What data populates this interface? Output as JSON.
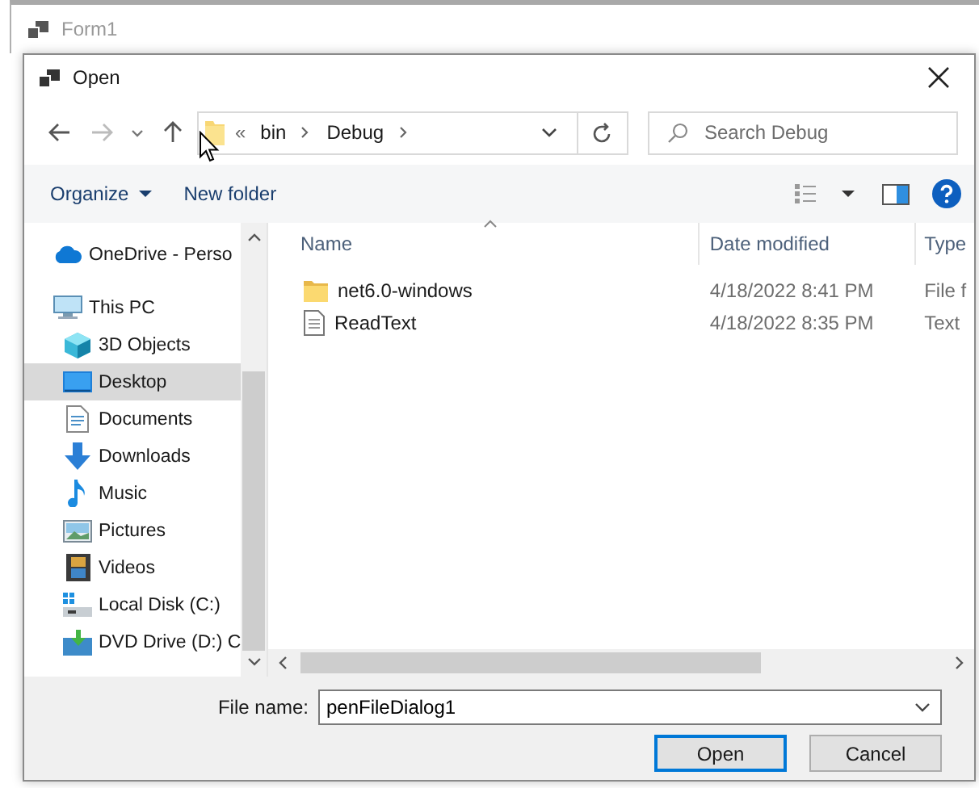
{
  "form": {
    "title": "Form1"
  },
  "dialog": {
    "title": "Open"
  },
  "address": {
    "overflow": "«",
    "segments": [
      "bin",
      "Debug"
    ]
  },
  "search": {
    "placeholder": "Search Debug"
  },
  "toolbar": {
    "organize": "Organize",
    "new_folder": "New folder"
  },
  "sidebar": {
    "items": [
      {
        "label": "OneDrive - Perso",
        "kind": "cloud",
        "selected": false
      },
      {
        "label": "This PC",
        "kind": "pc",
        "selected": false
      },
      {
        "label": "3D Objects",
        "kind": "cube",
        "selected": false
      },
      {
        "label": "Desktop",
        "kind": "desktop",
        "selected": true
      },
      {
        "label": "Documents",
        "kind": "document",
        "selected": false
      },
      {
        "label": "Downloads",
        "kind": "download",
        "selected": false
      },
      {
        "label": "Music",
        "kind": "music",
        "selected": false
      },
      {
        "label": "Pictures",
        "kind": "pictures",
        "selected": false
      },
      {
        "label": "Videos",
        "kind": "videos",
        "selected": false
      },
      {
        "label": "Local Disk (C:)",
        "kind": "disk",
        "selected": false
      },
      {
        "label": "DVD Drive (D:) C",
        "kind": "dvd",
        "selected": false
      }
    ]
  },
  "table": {
    "columns": [
      "Name",
      "Date modified",
      "Type"
    ],
    "rows": [
      {
        "kind": "folder",
        "name": "net6.0-windows",
        "date": "4/18/2022 8:41 PM",
        "type": "File f"
      },
      {
        "kind": "file",
        "name": "ReadText",
        "date": "4/18/2022 8:35 PM",
        "type": "Text"
      }
    ]
  },
  "file_name": {
    "label": "File name:",
    "value": "penFileDialog1"
  },
  "buttons": [
    {
      "label": "Open",
      "default": true
    },
    {
      "label": "Cancel",
      "default": false
    }
  ]
}
